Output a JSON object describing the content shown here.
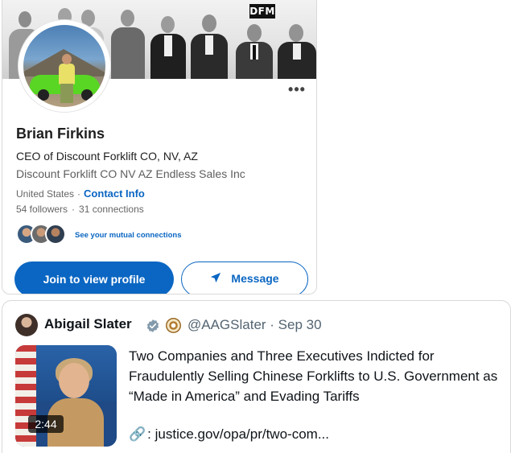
{
  "linkedin": {
    "banner_logo": "DFM",
    "name": "Brian Firkins",
    "headline": "CEO of Discount Forklift CO, NV, AZ",
    "company": "Discount Forklift CO NV AZ Endless Sales Inc",
    "location": "United States",
    "separator": "·",
    "contact_info_label": "Contact Info",
    "followers": "54 followers",
    "connections": "31 connections",
    "mutual_connections_label": "See your mutual connections",
    "join_button_label": "Join to view profile",
    "message_button_label": "Message",
    "more_label": "•••",
    "accent_color": "#0a66c2"
  },
  "tweet": {
    "author_name": "Abigail Slater",
    "handle_and_date": "@AAGSlater · Sep 30",
    "video_duration": "2:44",
    "text": "Two Companies and Three Executives Indicted for Fraudulently Selling Chinese Forklifts to U.S. Government as “Made in America” and Evading Tariffs",
    "link_icon": "🔗",
    "link_text": ": justice.gov/opa/pr/two-com...",
    "verified_color": "#829aab"
  }
}
